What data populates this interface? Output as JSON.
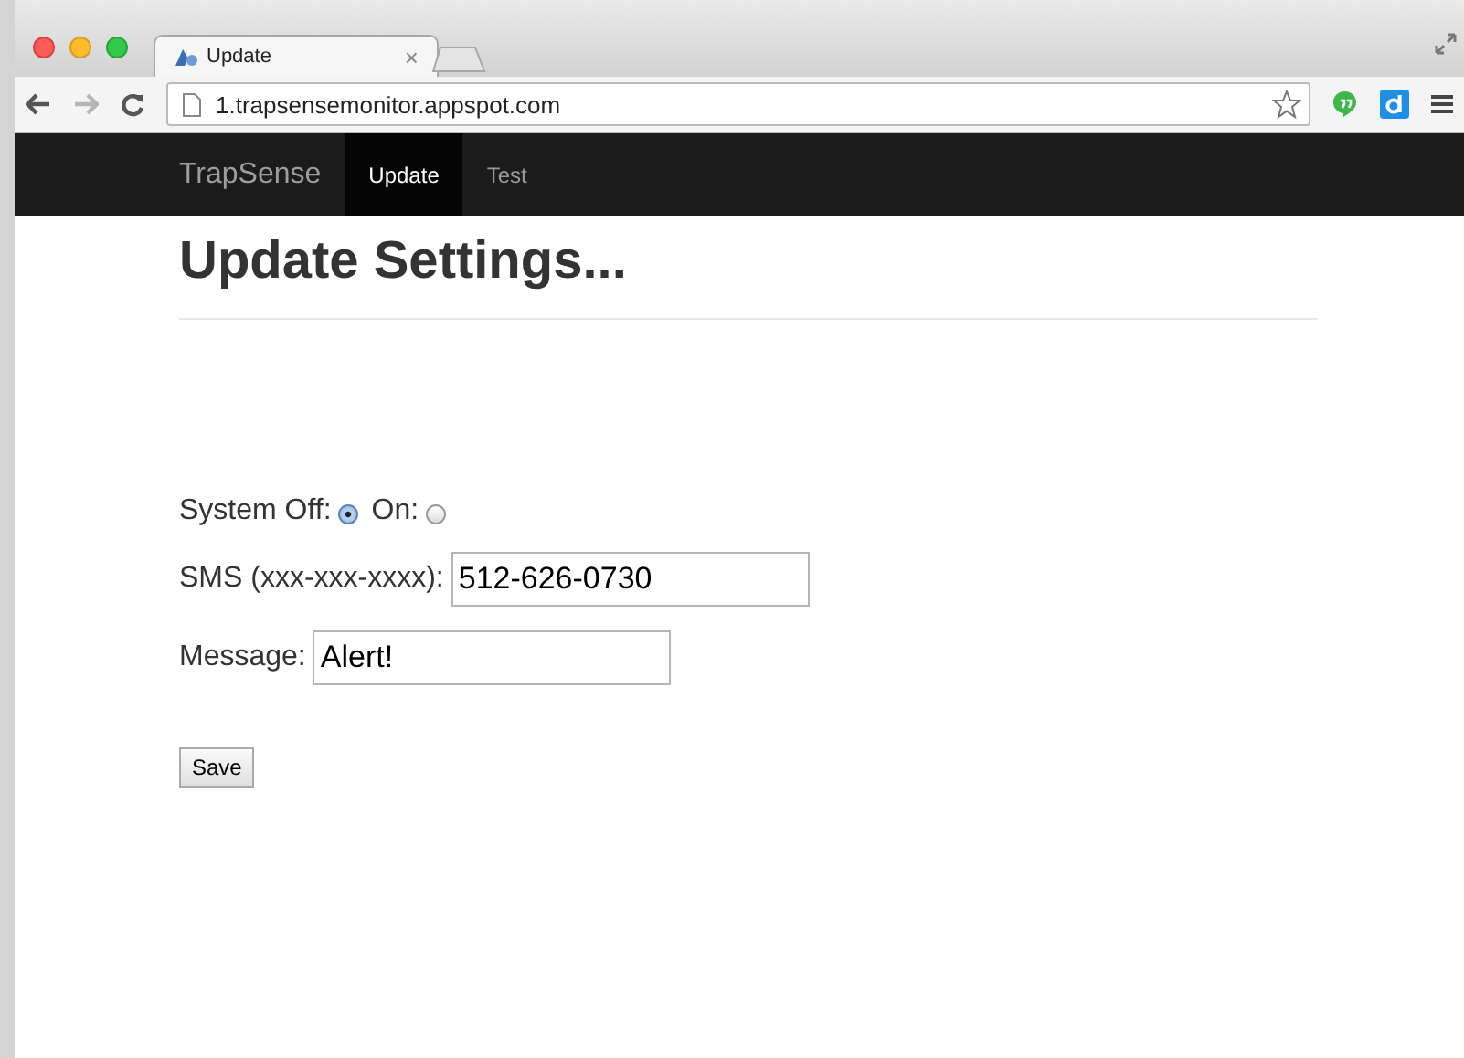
{
  "browser": {
    "tab_title": "Update",
    "tab_close": "×",
    "url": "1.trapsensemonitor.appspot.com"
  },
  "navbar": {
    "brand": "TrapSense",
    "items": [
      {
        "label": "Update",
        "selected": true
      },
      {
        "label": "Test",
        "selected": false
      }
    ]
  },
  "heading": "Update Settings...",
  "system": {
    "options": [
      {
        "label": "System Off:",
        "selected": true
      },
      {
        "label": "On:",
        "selected": false
      }
    ]
  },
  "fields": [
    {
      "label": "SMS (xxx-xxx-xxxx):",
      "value": "512-626-0730"
    },
    {
      "label": "Message:",
      "value": "Alert!"
    }
  ],
  "save_button": "Save"
}
